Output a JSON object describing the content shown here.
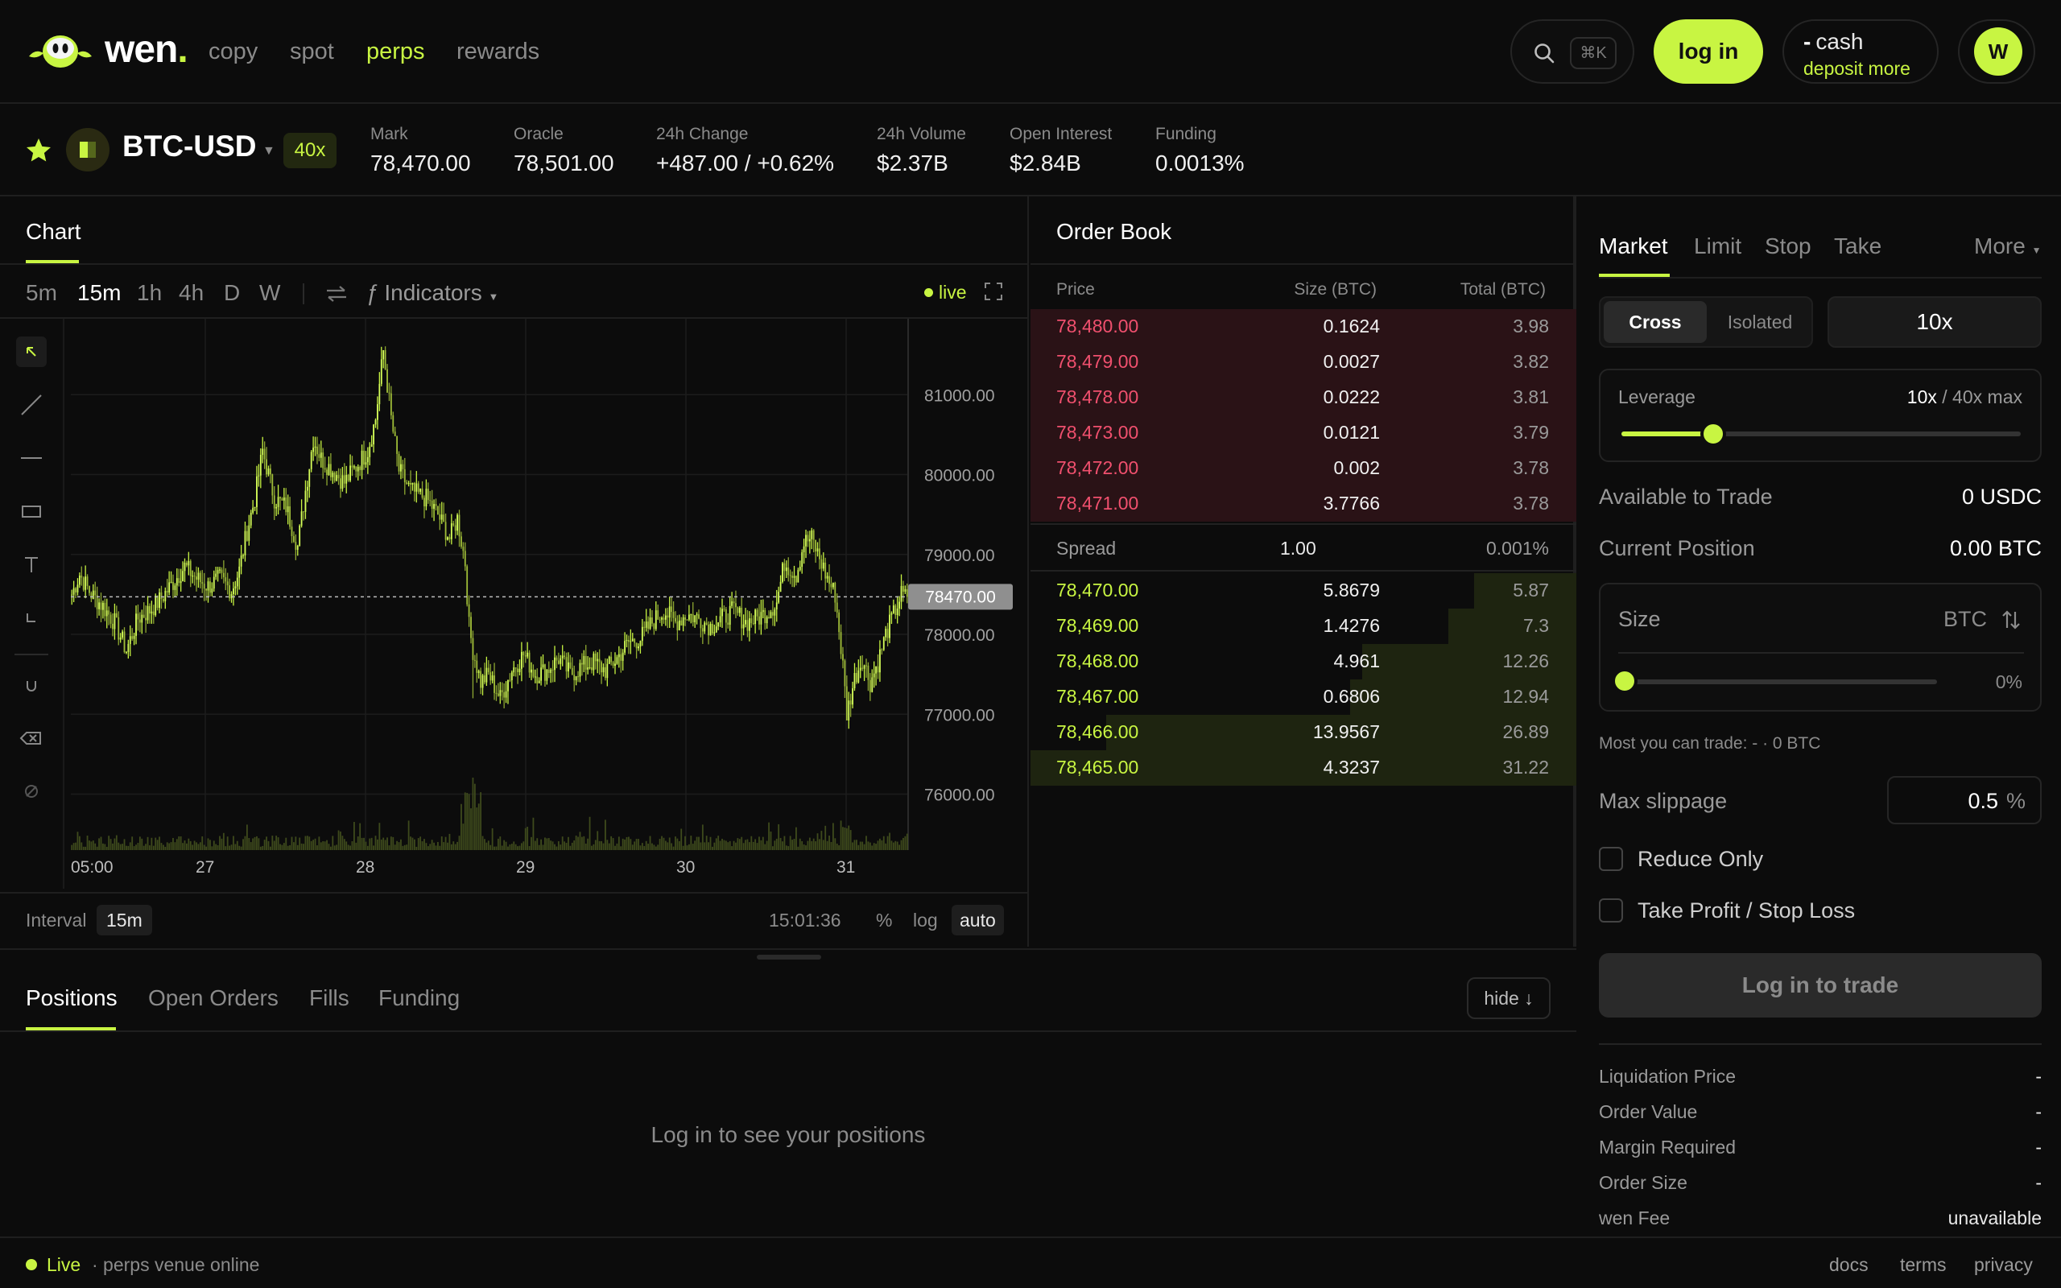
{
  "nav": {
    "brand": "wen",
    "brand_dot": ".",
    "links": [
      "copy",
      "spot",
      "perps",
      "rewards"
    ],
    "active_link": "perps",
    "search_shortcut": "⌘K",
    "login_label": "log in",
    "cash_label": "cash",
    "cash_amount": "-",
    "deposit_label": "deposit more",
    "avatar_letter": "W"
  },
  "market": {
    "symbol": "BTC-USD",
    "max_leverage": "40x",
    "stats": [
      {
        "label": "Mark",
        "value": "78,470.00",
        "tone": "normal"
      },
      {
        "label": "Oracle",
        "value": "78,501.00",
        "tone": "normal"
      },
      {
        "label": "24h Change",
        "value": "+487.00 / +0.62%",
        "tone": "positive"
      },
      {
        "label": "24h Volume",
        "value": "$2.37B",
        "tone": "normal"
      },
      {
        "label": "Open Interest",
        "value": "$2.84B",
        "tone": "normal"
      },
      {
        "label": "Funding",
        "value": "0.0013%",
        "tone": "positive"
      }
    ]
  },
  "chart_panel": {
    "tab": "Chart",
    "intervals": [
      "5m",
      "15m",
      "1h",
      "4h",
      "D",
      "W"
    ],
    "active_interval": "15m",
    "indicators_label": "Indicators",
    "live_label": "live",
    "interval_label": "Interval",
    "interval_value": "15m",
    "time": "15:01:36",
    "pct_label": "%",
    "log_label": "log",
    "auto_label": "auto"
  },
  "chart_data": {
    "type": "candlestick",
    "symbol": "BTC-USD",
    "interval": "15m",
    "x_tick_labels": [
      "05:00",
      "27",
      "28",
      "29",
      "30",
      "31"
    ],
    "y_tick_labels": [
      "81000.00",
      "80000.00",
      "79000.00",
      "78000.00",
      "77000.00",
      "76000.00"
    ],
    "ylim": [
      75300,
      81950
    ],
    "last_price": 78470.0,
    "last_price_label": "78470.00",
    "anchors_close": [
      [
        0,
        78500
      ],
      [
        4,
        78750
      ],
      [
        10,
        78500
      ],
      [
        16,
        78350
      ],
      [
        22,
        78150
      ],
      [
        28,
        77800
      ],
      [
        34,
        78200
      ],
      [
        40,
        78300
      ],
      [
        46,
        78450
      ],
      [
        52,
        78650
      ],
      [
        58,
        78850
      ],
      [
        64,
        78700
      ],
      [
        70,
        78600
      ],
      [
        76,
        78700
      ],
      [
        82,
        78550
      ],
      [
        86,
        78800
      ],
      [
        90,
        79300
      ],
      [
        94,
        79700
      ],
      [
        98,
        80300
      ],
      [
        104,
        79700
      ],
      [
        110,
        79600
      ],
      [
        116,
        79100
      ],
      [
        120,
        79800
      ],
      [
        124,
        80450
      ],
      [
        128,
        80200
      ],
      [
        134,
        80050
      ],
      [
        140,
        79900
      ],
      [
        146,
        80100
      ],
      [
        152,
        80300
      ],
      [
        156,
        80700
      ],
      [
        160,
        81550
      ],
      [
        164,
        80700
      ],
      [
        168,
        80050
      ],
      [
        174,
        79800
      ],
      [
        182,
        79700
      ],
      [
        188,
        79500
      ],
      [
        194,
        79200
      ],
      [
        198,
        79450
      ],
      [
        202,
        78900
      ],
      [
        204,
        78100
      ],
      [
        206,
        77800
      ],
      [
        210,
        77400
      ],
      [
        214,
        77500
      ],
      [
        220,
        77200
      ],
      [
        226,
        77550
      ],
      [
        232,
        77750
      ],
      [
        238,
        77500
      ],
      [
        244,
        77550
      ],
      [
        250,
        77700
      ],
      [
        256,
        77500
      ],
      [
        262,
        77600
      ],
      [
        268,
        77650
      ],
      [
        274,
        77550
      ],
      [
        280,
        77700
      ],
      [
        286,
        77900
      ],
      [
        292,
        77950
      ],
      [
        298,
        78150
      ],
      [
        304,
        78300
      ],
      [
        310,
        78150
      ],
      [
        316,
        78250
      ],
      [
        322,
        78200
      ],
      [
        328,
        78100
      ],
      [
        334,
        78200
      ],
      [
        340,
        78300
      ],
      [
        346,
        78150
      ],
      [
        352,
        78200
      ],
      [
        358,
        78300
      ],
      [
        362,
        78400
      ],
      [
        366,
        78900
      ],
      [
        372,
        78750
      ],
      [
        376,
        79150
      ],
      [
        380,
        79200
      ],
      [
        384,
        78950
      ],
      [
        388,
        78700
      ],
      [
        392,
        78500
      ],
      [
        396,
        77600
      ],
      [
        398,
        77000
      ],
      [
        402,
        77450
      ],
      [
        406,
        77700
      ],
      [
        410,
        77400
      ],
      [
        414,
        77650
      ],
      [
        418,
        78000
      ],
      [
        422,
        78250
      ],
      [
        426,
        78500
      ],
      [
        428,
        78470
      ]
    ],
    "high": 81550,
    "low": 76950,
    "volume_scale_max": 1
  },
  "orderbook": {
    "title": "Order Book",
    "headers": [
      "Price",
      "Size (BTC)",
      "Total (BTC)"
    ],
    "max_total": 31.22,
    "asks": [
      {
        "price": "78,480.00",
        "size": "0.1624",
        "total": "3.98"
      },
      {
        "price": "78,479.00",
        "size": "0.0027",
        "total": "3.82"
      },
      {
        "price": "78,478.00",
        "size": "0.0222",
        "total": "3.81"
      },
      {
        "price": "78,473.00",
        "size": "0.0121",
        "total": "3.79"
      },
      {
        "price": "78,472.00",
        "size": "0.002",
        "total": "3.78"
      },
      {
        "price": "78,471.00",
        "size": "3.7766",
        "total": "3.78"
      }
    ],
    "spread": {
      "label": "Spread",
      "value": "1.00",
      "pct": "0.001%"
    },
    "bids": [
      {
        "price": "78,470.00",
        "size": "5.8679",
        "total": "5.87"
      },
      {
        "price": "78,469.00",
        "size": "1.4276",
        "total": "7.3"
      },
      {
        "price": "78,468.00",
        "size": "4.961",
        "total": "12.26"
      },
      {
        "price": "78,467.00",
        "size": "0.6806",
        "total": "12.94"
      },
      {
        "price": "78,466.00",
        "size": "13.9567",
        "total": "26.89"
      },
      {
        "price": "78,465.00",
        "size": "4.3237",
        "total": "31.22"
      }
    ]
  },
  "order_form": {
    "types": [
      "Market",
      "Limit",
      "Stop",
      "Take"
    ],
    "more_label": "More",
    "cross_label": "Cross",
    "isolated_label": "Isolated",
    "leverage_button": "10x",
    "leverage_label": "Leverage",
    "leverage_value": "10x",
    "leverage_max": "/ 40x max",
    "leverage_fraction": 0.23,
    "available_label": "Available to Trade",
    "available_value": "0 USDC",
    "position_label": "Current Position",
    "position_value": "0.00 BTC",
    "size_label": "Size",
    "size_unit": "BTC",
    "size_pct": "0%",
    "most_trade": "Most you can trade: - · 0 BTC",
    "slippage_label": "Max slippage",
    "slippage_value": "0.5",
    "slippage_unit": "%",
    "reduce_only_label": "Reduce Only",
    "tpsl_label": "Take Profit / Stop Loss",
    "trade_button": "Log in to trade",
    "summary": [
      {
        "label": "Liquidation Price",
        "value": "-"
      },
      {
        "label": "Order Value",
        "value": "-"
      },
      {
        "label": "Margin Required",
        "value": "-"
      },
      {
        "label": "Order Size",
        "value": "-"
      },
      {
        "label": "wen Fee",
        "value": "unavailable"
      }
    ]
  },
  "positions": {
    "tabs": [
      "Positions",
      "Open Orders",
      "Fills",
      "Funding"
    ],
    "active_tab": "Positions",
    "hide_label": "hide ↓",
    "empty_message": "Log in to see your positions"
  },
  "footer": {
    "status_label": "Live",
    "status_text": "· perps venue online",
    "links": [
      "docs",
      "terms",
      "privacy"
    ]
  },
  "colors": {
    "accent": "#c8f542",
    "ask": "#f0506e",
    "background": "#0c0c0c"
  }
}
